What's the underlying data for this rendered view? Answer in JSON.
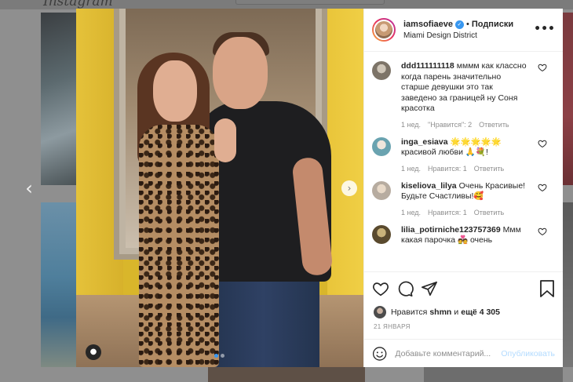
{
  "background": {
    "logo_text": "Instagram"
  },
  "post": {
    "username": "iamsofiaeve",
    "verified": true,
    "separator": "•",
    "follow_label": "Подписки",
    "location": "Miami Design District",
    "more_label": "•••",
    "carousel": {
      "slide_count": 2,
      "active_slide": 1
    }
  },
  "comments": [
    {
      "username": "ddd111111118",
      "text": "мммм как классно когда парень значительно старше девушки это так заведено за границей ну Соня красотка",
      "time": "1 нед.",
      "likes": "\"Нравится\": 2",
      "reply": "Ответить",
      "avatar_color": "#7d7468"
    },
    {
      "username": "inga_esiava",
      "text": "🌟🌟🌟🌟🌟 красивой любви 🙏💐!",
      "time": "1 нед.",
      "likes": "Нравится: 1",
      "reply": "Ответить",
      "avatar_color": "#6aa3b0"
    },
    {
      "username": "kiseliova_lilya",
      "text": "Очень Красивые! Будьте Счастливы!🥰",
      "time": "1 нед.",
      "likes": "Нравится: 1",
      "reply": "Ответить",
      "avatar_color": "#b7aca0"
    },
    {
      "username": "lilia_potirniche123757369",
      "text": "Ммм какая парочка 💑 очень",
      "time": "",
      "likes": "",
      "reply": "",
      "avatar_color": "#5a4a2e"
    }
  ],
  "likes_line": {
    "prefix": "Нравится",
    "user": "shmn",
    "middle": "и",
    "count": "ещё 4 305"
  },
  "date": "21 января",
  "add_comment": {
    "placeholder": "Добавьте комментарий...",
    "publish_label": "Опубликовать"
  },
  "colors": {
    "accent": "#3897f0",
    "publish_disabled": "#b3dbff",
    "muted_text": "#8e8e8e"
  },
  "icons": {
    "prev": "chevron-left-icon",
    "next": "chevron-right-icon",
    "user_tag": "user-icon",
    "like": "heart-icon",
    "comment": "comment-icon",
    "share": "send-icon",
    "save": "bookmark-icon",
    "emoji": "smiley-icon"
  }
}
